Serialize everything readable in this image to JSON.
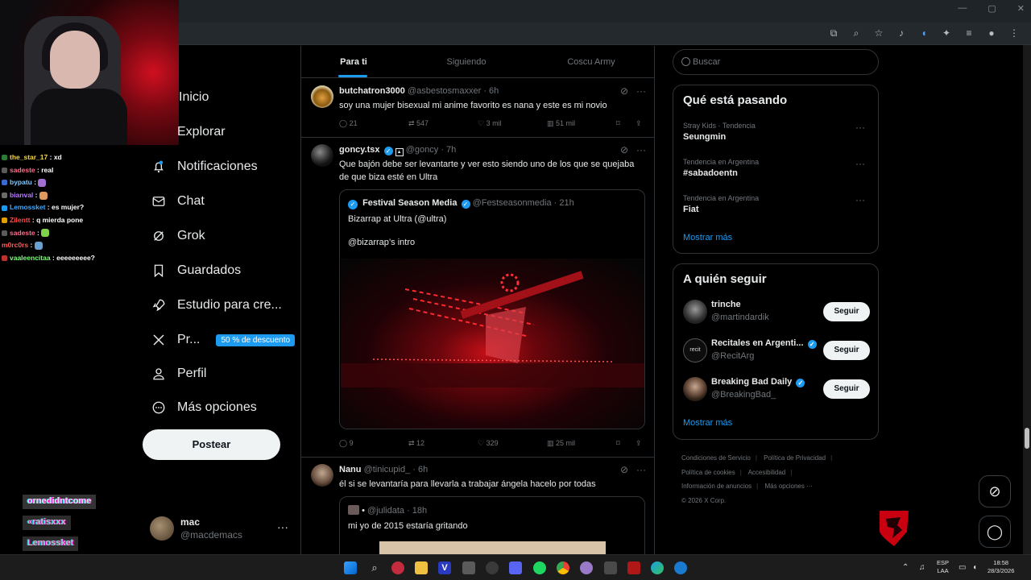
{
  "browser": {
    "win_min": "—",
    "win_max": "▢",
    "win_close": "✕"
  },
  "chat": [
    {
      "user": "the_star_17",
      "color": "#f2d54a",
      "msg": "xd",
      "badge": "#2a7a3a"
    },
    {
      "user": "sadeste",
      "color": "#ff6b8a",
      "msg": "real",
      "badge": "#5a5a5a"
    },
    {
      "user": "bypatu",
      "color": "#7ec8ff",
      "msg": "",
      "badge": "#3a6ad0",
      "emote": "#a070d0"
    },
    {
      "user": "bianval",
      "color": "#b57cff",
      "msg": "",
      "badge": "#6a6a6a",
      "emote": "#e09a60"
    },
    {
      "user": "Lemossket",
      "color": "#3fa9ff",
      "msg": "es mujer?",
      "badge": "#1d9bf0"
    },
    {
      "user": "Zilentt",
      "color": "#ff4b4b",
      "msg": "q mierda pone",
      "badge": "#e0a000"
    },
    {
      "user": "sadeste",
      "color": "#ff6b8a",
      "msg": "",
      "badge": "#5a5a5a",
      "emote": "#7fd04a"
    },
    {
      "user": "m0rc0rs",
      "color": "#ff5a5a",
      "msg": "",
      "badge": "",
      "emote": "#6aa0d0"
    },
    {
      "user": "vaaleencitaa",
      "color": "#7dff7d",
      "msg": "eeeeeeeee?",
      "badge": "#c03030"
    }
  ],
  "overlay_glitch": [
    "ornedidntcome",
    "«ratisxxx",
    "Lemossket"
  ],
  "nav": {
    "items": [
      {
        "label": "Inicio",
        "icon": "home-icon"
      },
      {
        "label": "Explorar",
        "icon": "search-icon"
      },
      {
        "label": "Notificaciones",
        "icon": "bell-icon"
      },
      {
        "label": "Chat",
        "icon": "mail-icon"
      },
      {
        "label": "Grok",
        "icon": "grok-icon"
      },
      {
        "label": "Guardados",
        "icon": "bookmark-icon"
      },
      {
        "label": "Estudio para cre...",
        "icon": "rocket-icon"
      },
      {
        "label": "Pr...",
        "icon": "x-logo-icon",
        "badge": "50 % de descuento"
      },
      {
        "label": "Perfil",
        "icon": "person-icon"
      },
      {
        "label": "Más opciones",
        "icon": "more-circle-icon"
      }
    ],
    "post_button": "Postear",
    "account": {
      "name": "mac",
      "handle": "@macdemacs",
      "more": "···"
    }
  },
  "timeline": {
    "tabs": [
      "Para ti",
      "Siguiendo",
      "Coscu Army"
    ],
    "tweets": [
      {
        "name": "butchatron3000",
        "handle": "@asbestosmaxxer",
        "time": "· 6h",
        "text": "soy una mujer bisexual mi anime favorito es nana y este es mi novio",
        "replies": "21",
        "reposts": "547",
        "likes": "3 mil",
        "views": "51 mil"
      },
      {
        "name": "goncy.tsx",
        "handle": "@goncy",
        "time": "· 7h",
        "text": "Que bajón debe ser levantarte y ver esto siendo uno de los que se quejaba de que biza esté en Ultra",
        "quote": {
          "name": "Festival Season Media",
          "handle": "@Festseasonmedia",
          "time": "· 21h",
          "line1": "Bizarrap at Ultra (@ultra)",
          "line2": "@bizarrap’s intro"
        },
        "replies": "9",
        "reposts": "12",
        "likes": "329",
        "views": "25 mil"
      },
      {
        "name": "Nanu",
        "handle": "@tinicupid_",
        "time": "· 6h",
        "text": "él si se levantaría para llevarla a trabajar ángela hacelo por todas",
        "quote": {
          "handle": "@julidata",
          "time": "· 18h",
          "line1": "mi yo de 2015 estaría gritando"
        }
      }
    ]
  },
  "sidebar": {
    "search_placeholder": "Buscar",
    "trends_title": "Qué está pasando",
    "trends": [
      {
        "meta": "Stray Kids · Tendencia",
        "name": "Seungmin"
      },
      {
        "meta": "Tendencia en Argentina",
        "name": "#sabadoentn"
      },
      {
        "meta": "Tendencia en Argentina",
        "name": "Fiat"
      }
    ],
    "show_more": "Mostrar más",
    "follow_title": "A quién seguir",
    "follow": [
      {
        "name": "trinche",
        "handle": "@martindardik",
        "verified": false
      },
      {
        "name": "Recitales en Argenti...",
        "handle": "@RecitArg",
        "verified": true
      },
      {
        "name": "Breaking Bad Daily",
        "handle": "@BreakingBad_",
        "verified": true
      }
    ],
    "follow_button": "Seguir",
    "footer": [
      "Condiciones de Servicio",
      "Política de Privacidad",
      "Política de cookies",
      "Accesibilidad",
      "Información de anuncios",
      "Más opciones ···",
      "© 2026 X Corp."
    ]
  },
  "taskbar": {
    "lang_1": "ESP",
    "lang_2": "LAA",
    "time": "18:58",
    "date": "28/3/2026"
  }
}
